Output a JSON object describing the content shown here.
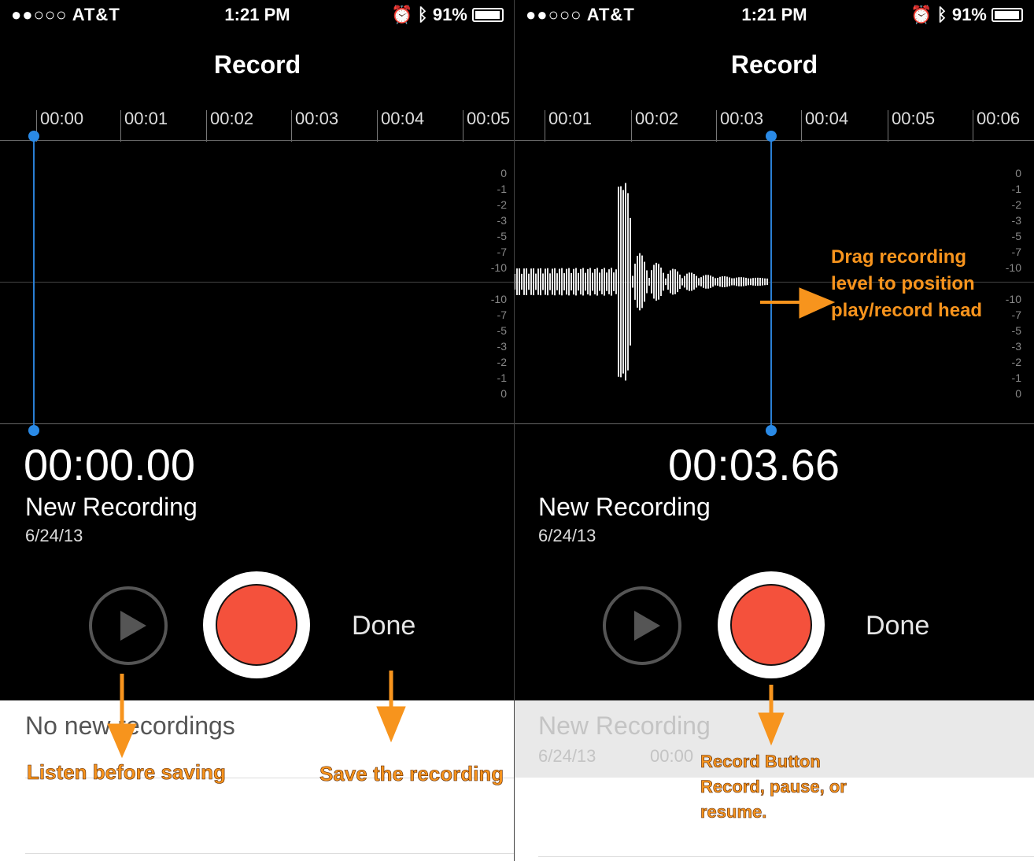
{
  "status": {
    "carrier": "●●○○○ AT&T",
    "time": "1:21 PM",
    "battery": "91%"
  },
  "nav": {
    "title": "Record"
  },
  "left": {
    "ruler": [
      "00:00",
      "00:01",
      "00:02",
      "00:03",
      "00:04",
      "00:05"
    ],
    "elapsed": "00:00.00",
    "name": "New Recording",
    "date": "6/24/13",
    "done": "Done",
    "list_empty": "No new recordings",
    "annotation_listen": "Listen before saving",
    "annotation_save": "Save the recording"
  },
  "right": {
    "ruler": [
      "00:01",
      "00:02",
      "00:03",
      "00:04",
      "00:05",
      "00:06"
    ],
    "elapsed": "00:03.66",
    "name": "New Recording",
    "date": "6/24/13",
    "done": "Done",
    "list_item_name": "New Recording",
    "list_item_date": "6/24/13",
    "list_item_duration": "00:00",
    "annotation_drag": [
      "Drag recording",
      "level to position",
      "play/record head"
    ],
    "annotation_record": [
      "Record Button",
      "Record, pause, or",
      "resume."
    ]
  },
  "db_scale": {
    "upper": [
      "0",
      "-1",
      "-2",
      "-3",
      "-5",
      "-7",
      "-10"
    ],
    "lower": [
      "-10",
      "-7",
      "-5",
      "-3",
      "-2",
      "-1",
      "0"
    ]
  },
  "colors": {
    "accent_blue": "#2a8ae6",
    "record_red": "#f4513c",
    "annotation_orange": "#f7941d"
  }
}
